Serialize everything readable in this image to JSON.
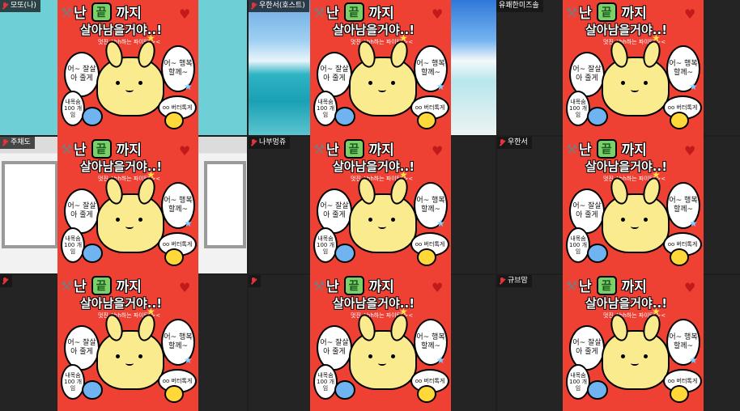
{
  "participants": [
    {
      "name": "모또(나)",
      "muted": true
    },
    {
      "name": "우한서(호스트)",
      "muted": true
    },
    {
      "name": "유쾌한미즈솔",
      "muted": false
    },
    {
      "name": "주채도",
      "muted": true
    },
    {
      "name": "나부멍쥬",
      "muted": true
    },
    {
      "name": "우한서",
      "muted": true
    },
    {
      "name": "",
      "muted": true
    },
    {
      "name": "",
      "muted": true
    },
    {
      "name": "규브맘",
      "muted": true
    }
  ],
  "poster": {
    "title_left": "난",
    "title_badge": "끝",
    "title_right": "까지",
    "subtitle": "살아남을거야..!",
    "small_text": "멋진 Ahh하는 파이팅 ><",
    "bubble_left": "어~ 잘살아 줄게",
    "bubble_right": "어~ 행복 할께~",
    "bubble_small": "내목숨 100 개임",
    "bubble_chick": "oo 버터톡게"
  },
  "colors": {
    "poster_bg": "#ef4034",
    "muted_icon": "#e0353a",
    "tile_bg": "#242424"
  }
}
